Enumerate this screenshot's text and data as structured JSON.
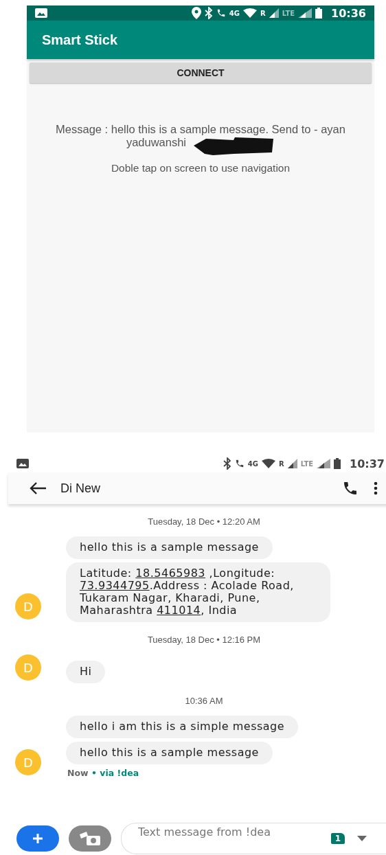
{
  "app_screen": {
    "status_bar": {
      "time": "10:36",
      "network": "4G",
      "roaming": "R",
      "lte": "LTE"
    },
    "app_bar": {
      "title": "Smart Stick"
    },
    "connect_button": {
      "label": "CONNECT"
    },
    "message_text": "Message : hello this is a sample message. Send to - ayan yaduwanshi",
    "redacted": true,
    "hint": "Doble tap on screen to use navigation"
  },
  "messages_screen": {
    "status_bar": {
      "time": "10:37",
      "network": "4G",
      "roaming": "R",
      "lte": "LTE"
    },
    "header": {
      "title": "Di New"
    },
    "groups": [
      {
        "timestamp": "Tuesday, 18 Dec • 12:20 AM",
        "avatar": "D",
        "bubbles": [
          [
            {
              "text": "hello this is a sample message",
              "link": false
            }
          ],
          [
            {
              "text": "Latitude: ",
              "link": false
            },
            {
              "text": "18.5465983",
              "link": true
            },
            {
              "text": " ,Longitude: ",
              "link": false
            },
            {
              "text": "73.9344795",
              "link": true
            },
            {
              "text": ".Address : Acolade Road, Tukaram Nagar, Kharadi, Pune, Maharashtra ",
              "link": false
            },
            {
              "text": "411014",
              "link": true
            },
            {
              "text": ", India",
              "link": false
            }
          ]
        ]
      },
      {
        "timestamp": "Tuesday, 18 Dec • 12:16 PM",
        "avatar": "D",
        "bubbles": [
          [
            {
              "text": "Hi",
              "link": false
            }
          ]
        ]
      },
      {
        "timestamp": "10:36 AM",
        "avatar": "D",
        "bubbles": [
          [
            {
              "text": "hello i am this is a simple message",
              "link": false
            }
          ],
          [
            {
              "text": "hello this is a sample message",
              "link": false
            }
          ]
        ],
        "status": "Now",
        "via": "• via !dea"
      }
    ],
    "composer": {
      "placeholder": "Text message from !dea",
      "sim": "1"
    }
  }
}
